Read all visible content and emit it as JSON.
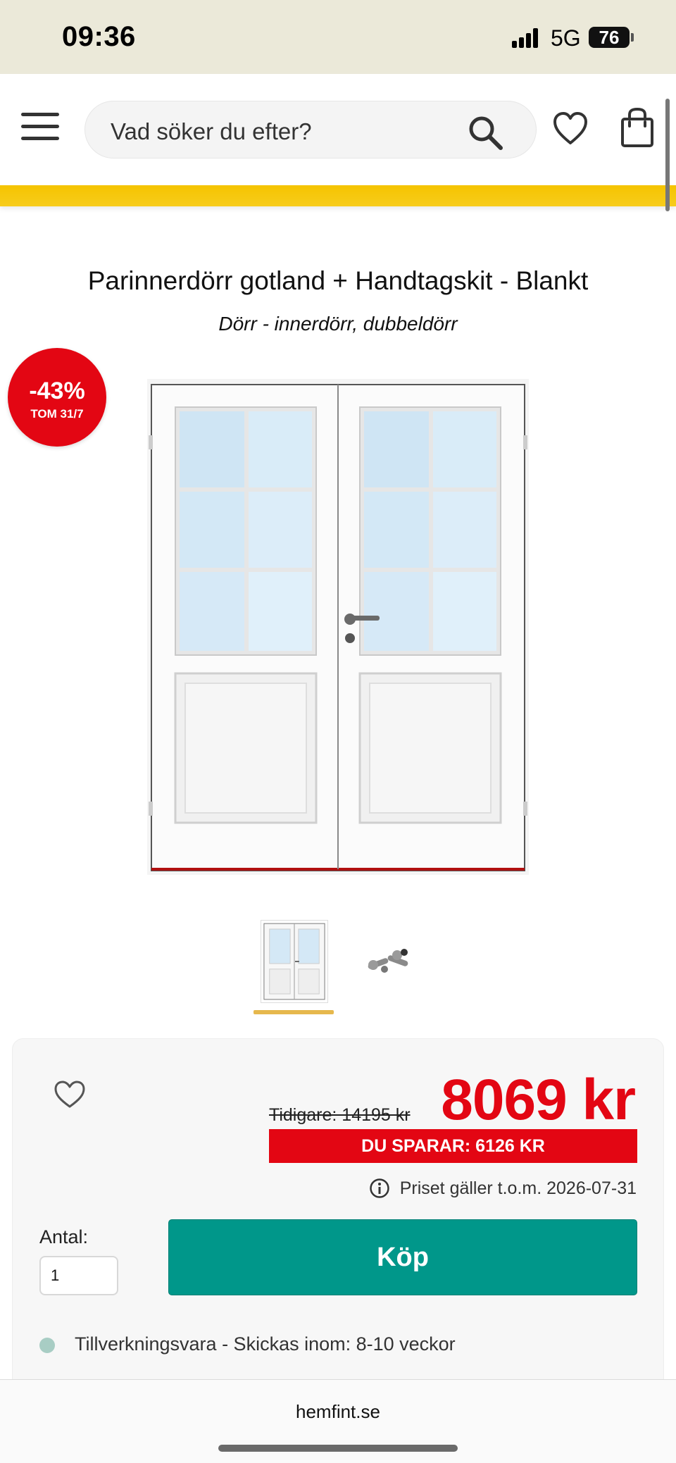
{
  "status_bar": {
    "time": "09:36",
    "network": "5G",
    "battery": "76"
  },
  "header": {
    "search_placeholder": "Vad söker du efter?",
    "icons": [
      "menu-icon",
      "search-icon",
      "heart-icon",
      "shopping-bag-icon"
    ],
    "accent_color": "#f5c400"
  },
  "product": {
    "title": "Parinnerdörr gotland + Handtagskit - Blankt",
    "subtitle": "Dörr - innerdörr, dubbeldörr",
    "badge": {
      "percent": "-43%",
      "date": "TOM 31/7",
      "color": "#e30613"
    },
    "thumbnails": [
      "door-thumbnail",
      "handle-kit-thumbnail"
    ],
    "selected_thumbnail": 0
  },
  "price_card": {
    "old_price": "Tidigare: 14195 kr",
    "new_price": "8069 kr",
    "save_text": "DU SPARAR: 6126 KR",
    "valid_text": "Priset gäller t.o.m. 2026-07-31",
    "qty_label": "Antal:",
    "qty_value": "1",
    "buy_label": "Köp",
    "buy_color": "#00978a",
    "stock_text": "Tillverkningsvara - Skickas inom: 8-10 veckor"
  },
  "browser": {
    "url": "hemfint.se"
  }
}
